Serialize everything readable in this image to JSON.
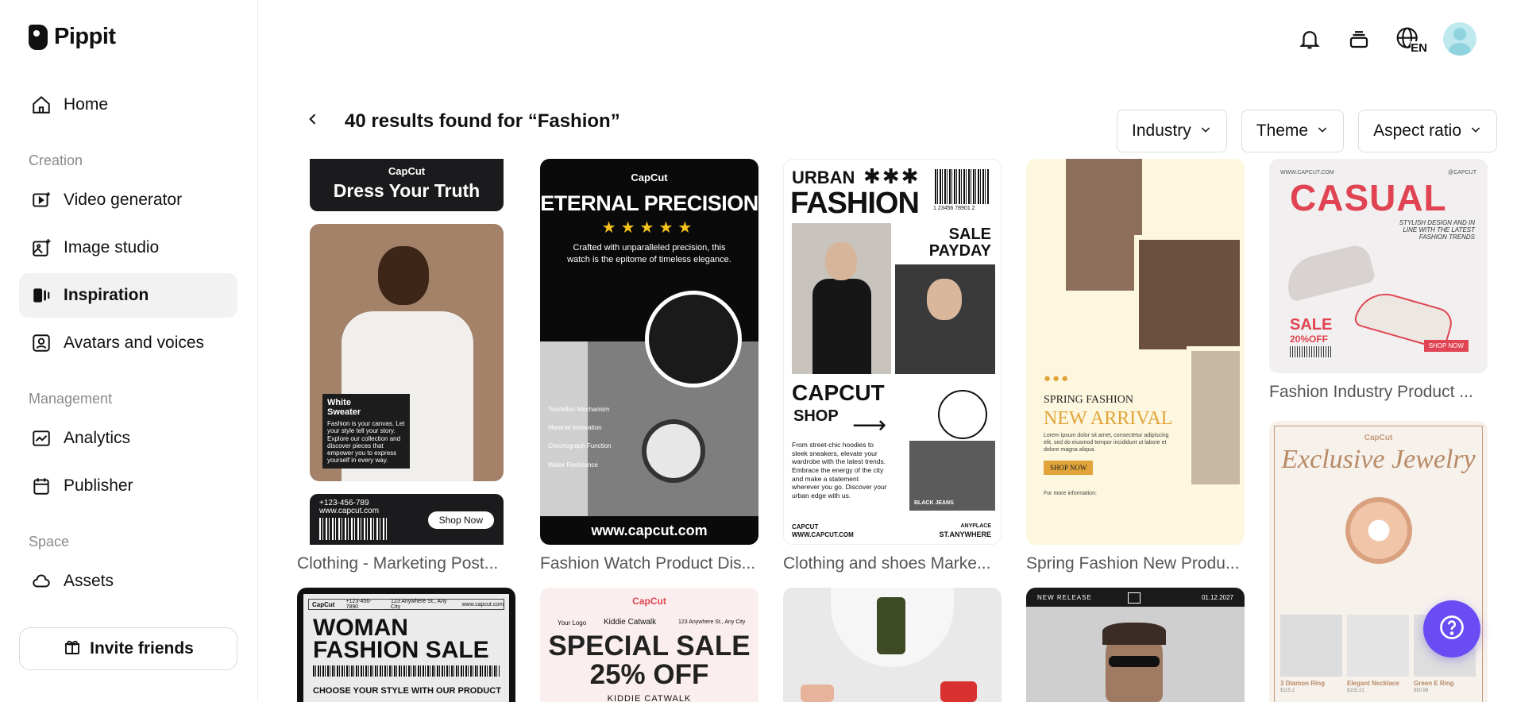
{
  "app": {
    "name": "Pippit"
  },
  "sidebar": {
    "items": [
      {
        "label": "Home",
        "icon": "home-icon"
      },
      {
        "label": "Video generator",
        "icon": "video-icon"
      },
      {
        "label": "Image studio",
        "icon": "image-icon"
      },
      {
        "label": "Inspiration",
        "icon": "inspiration-icon",
        "active": true
      },
      {
        "label": "Avatars and voices",
        "icon": "avatar-icon"
      },
      {
        "label": "Analytics",
        "icon": "chart-icon"
      },
      {
        "label": "Publisher",
        "icon": "calendar-icon"
      },
      {
        "label": "Assets",
        "icon": "cloud-icon"
      }
    ],
    "sections": {
      "creation": "Creation",
      "management": "Management",
      "space": "Space"
    },
    "invite_label": "Invite friends"
  },
  "header": {
    "lang": "EN"
  },
  "results": {
    "title": "40 results found for “Fashion”",
    "filters": [
      "Industry",
      "Theme",
      "Aspect ratio"
    ]
  },
  "cards": [
    {
      "caption": "Clothing - Marketing Post...",
      "brand": "CapCut",
      "headline": "Dress Your Truth",
      "label_title": "White Sweater",
      "label_body": "Fashion is your canvas. Let your style tell your story. Explore our collection and discover pieces that empower you to express yourself in every way.",
      "phone": "+123-456-789",
      "site": "www.capcut.com",
      "cta": "Shop Now"
    },
    {
      "caption": "Fashion Watch Product Dis...",
      "brand": "CapCut",
      "headline": "ETERNAL PRECISION",
      "stars": "★★★★★",
      "body": "Crafted with unparalleled precision, this watch is the epitome of timeless elegance.",
      "features": [
        "Tourbillon Mechanism",
        "Material Innovation",
        "Chronograph Function",
        "Water Resistance"
      ],
      "site": "www.capcut.com"
    },
    {
      "caption": "Clothing and shoes Marke...",
      "line1": "URBAN",
      "line2": "FASHION",
      "stars": "✱✱✱",
      "barcode_num": "1 23456 78901 2",
      "sale": "SALE",
      "payday": "PAYDAY",
      "brand": "CAPCUT",
      "shop": "SHOP",
      "body": "From street-chic hoodies to sleek sneakers, elevate your wardrobe with the latest trends. Embrace the energy of the city and make a statement wherever you go. Discover your urban edge with us.",
      "tag": "BLACK JEANS",
      "foot_left": "CAPCUT WWW.CAPCUT.COM",
      "foot_right_top": "ANYPLACE",
      "foot_right": "ST.ANYWHERE"
    },
    {
      "caption": "Spring Fashion New Produ...",
      "kicker": "SPRING FASHION",
      "headline": "NEW ARRIVAL",
      "body": "Lorem ipsum dolor sit amet, consectetur adipiscing elit, sed do eiusmod tempor incididunt ut labore et dolore magna aliqua.",
      "cta": "SHOP NOW",
      "info": "For more information:"
    },
    {
      "caption": "Fashion Industry Product ...",
      "site": "WWW.CAPCUT.COM",
      "handle": "@CAPCUT",
      "headline": "CASUAL",
      "tagline": "STYLISH DESIGN AND IN LINE WITH THE LATEST FASHION TRENDS",
      "sale": "SALE",
      "off": "20%OFF",
      "cta": "SHOP NOW"
    },
    {
      "brand": "CapCut",
      "headline": "Exclusive Jewelry",
      "items": [
        {
          "name": "3 Diamon Ring",
          "price": "$115.2"
        },
        {
          "name": "Elegant Necklace",
          "price": "$155.21"
        },
        {
          "name": "Green E Ring",
          "price": "$50.99"
        }
      ]
    },
    {
      "brand": "CapCut",
      "phone": "+123-456-7890",
      "addr": "123 Anywhere St., Any City",
      "site": "www.capcut.com",
      "headline1": "WOMAN",
      "headline2": "FASHION SALE",
      "sub": "CHOOSE YOUR STYLE WITH OUR PRODUCT"
    },
    {
      "brand": "CapCut",
      "logo": "Your Logo",
      "name": "Kiddie Catwalk",
      "addr": "123 Anywhere St., Any City",
      "headline1": "SPECIAL SALE",
      "headline2": "25% OFF",
      "foot": "KIDDIE CATWALK"
    },
    {},
    {
      "kicker": "NEW RELEASE",
      "date": "01.12.2027"
    }
  ]
}
